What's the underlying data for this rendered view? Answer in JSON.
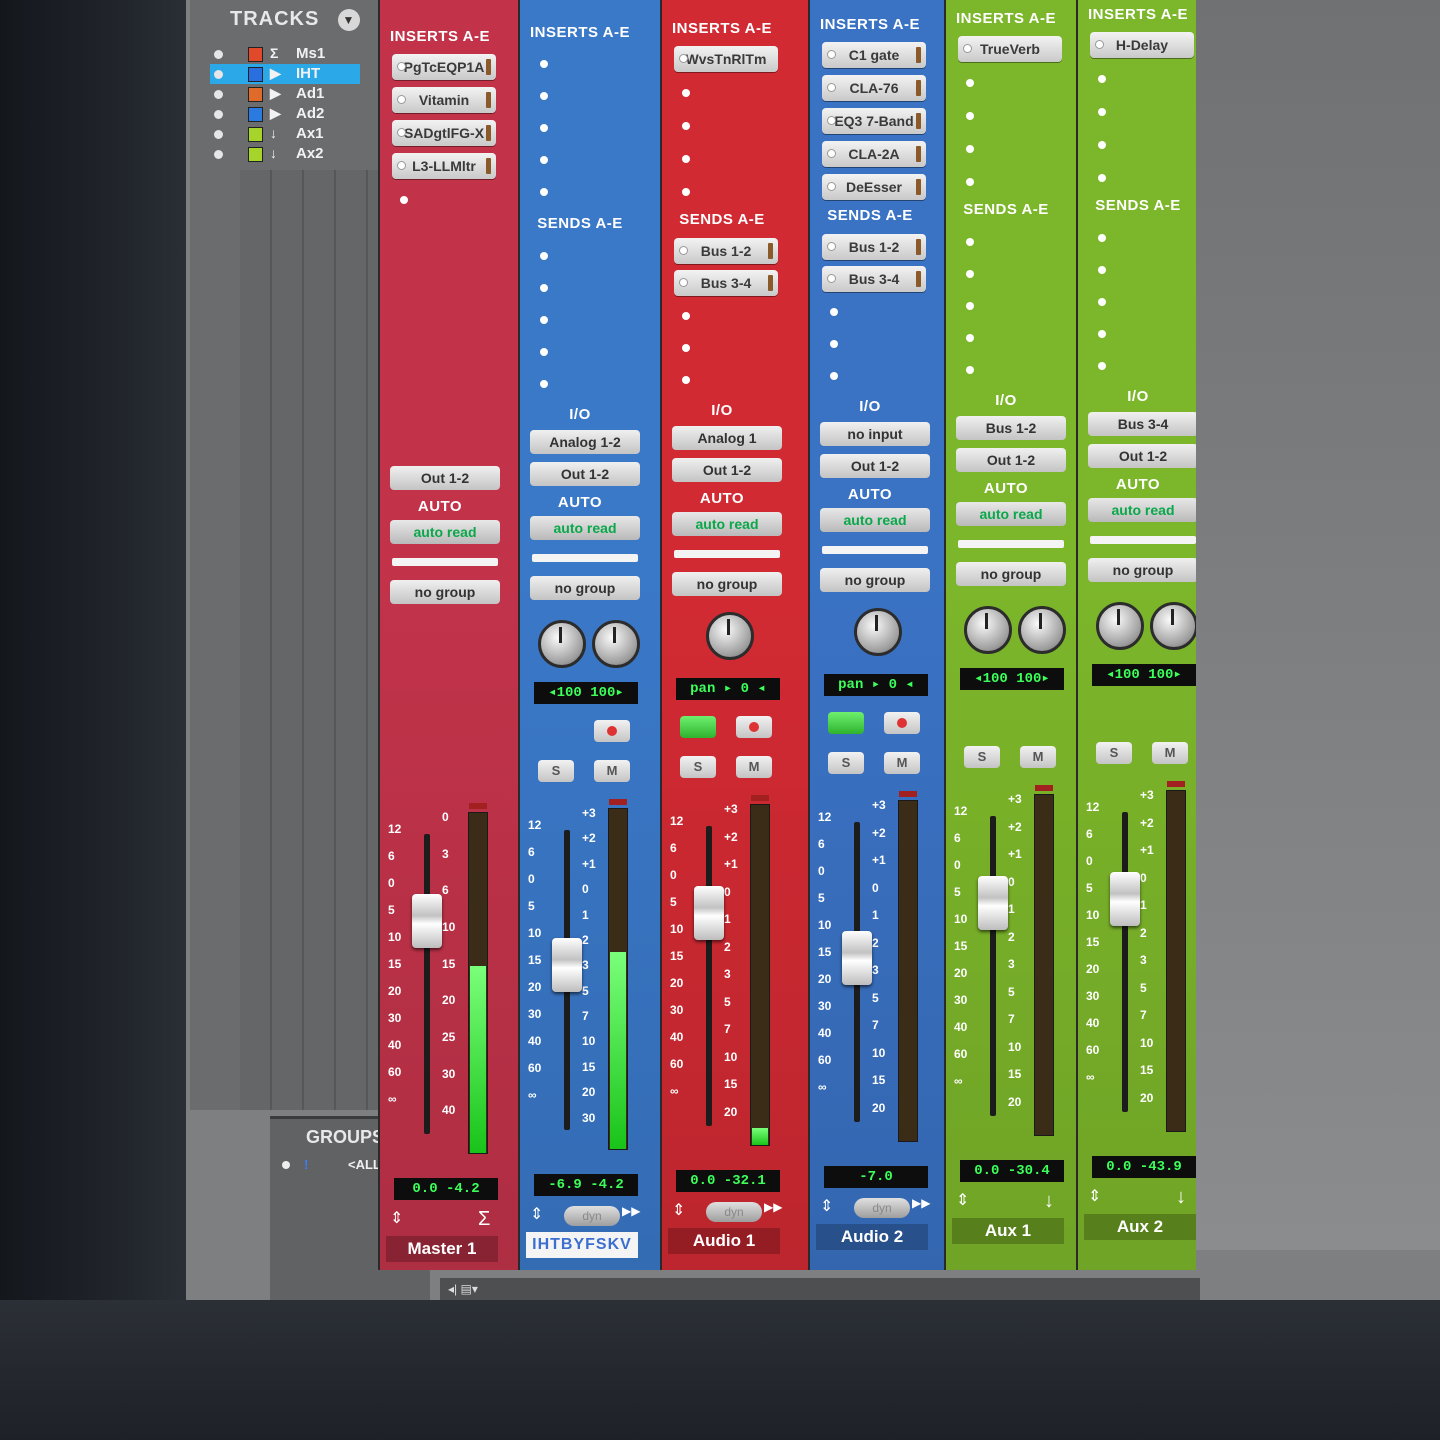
{
  "tracks_panel": {
    "title": "TRACKS",
    "menu_glyph": "▼",
    "tracks": [
      {
        "name": "Ms1",
        "color": "#e04a2a",
        "icon": "Σ"
      },
      {
        "name": "IHT",
        "color": "#2a6fe0",
        "icon": "▶",
        "selected": true
      },
      {
        "name": "Ad1",
        "color": "#e06a2a",
        "icon": "▶"
      },
      {
        "name": "Ad2",
        "color": "#2a7ae0",
        "icon": "▶"
      },
      {
        "name": "Ax1",
        "color": "#a6d42a",
        "icon": "↓"
      },
      {
        "name": "Ax2",
        "color": "#a6d42a",
        "icon": "↓"
      }
    ]
  },
  "groups_panel": {
    "title": "GROUPS",
    "menu_glyph": "▼",
    "all_label": "<ALL>",
    "id_label": "!"
  },
  "footer": {
    "label": "◂| ▤▾"
  },
  "strips": [
    {
      "name": "Master 1",
      "color": "#c2334a",
      "inserts_title": "INSERTS A-E",
      "inserts": [
        "PgTcEQP1A",
        "Vitamin",
        "SADgtlFG-X",
        "L3-LLMltr"
      ],
      "sends_title": "",
      "sends": [],
      "io_title": "",
      "io_input": "",
      "io_output": "Out 1-2",
      "auto_title": "AUTO",
      "auto_mode": "auto read",
      "group": "no group",
      "pan": [],
      "buttons": [],
      "vol": "0.0",
      "peak": "-4.2",
      "bottom_icon": "Σ",
      "scale_fader": [
        "12",
        "6",
        "0",
        "5",
        "10",
        "15",
        "20",
        "30",
        "40",
        "60",
        "∞"
      ],
      "scale_meter": [
        "0",
        "3",
        "6",
        "10",
        "15",
        "20",
        "25",
        "30",
        "40"
      ],
      "meter_level": 0.55
    },
    {
      "name": "IHTBYFSKV",
      "color": "#3a78c8",
      "inserts_title": "INSERTS A-E",
      "inserts": [],
      "sends_title": "SENDS A-E",
      "sends": [],
      "io_title": "I/O",
      "io_input": "Analog 1-2",
      "io_output": "Out 1-2",
      "auto_title": "AUTO",
      "auto_mode": "auto read",
      "group": "no group",
      "pan": [
        "◂100",
        "100▸"
      ],
      "buttons": [
        "rec",
        "S",
        "M"
      ],
      "vol": "-6.9",
      "peak": "-4.2",
      "bottom_icon": "dyn",
      "scale_fader": [
        "12",
        "6",
        "0",
        "5",
        "10",
        "15",
        "20",
        "30",
        "40",
        "60",
        "∞"
      ],
      "scale_meter": [
        "+3",
        "+2",
        "+1",
        "0",
        "1",
        "2",
        "3",
        "5",
        "7",
        "10",
        "15",
        "20",
        "30"
      ],
      "meter_level": 0.58
    },
    {
      "name": "Audio 1",
      "color": "#d22a33",
      "inserts_title": "INSERTS A-E",
      "inserts": [
        "WvsTnRlTm"
      ],
      "sends_title": "SENDS A-E",
      "sends": [
        "Bus 1-2",
        "Bus 3-4"
      ],
      "io_title": "I/O",
      "io_input": "Analog 1",
      "io_output": "Out 1-2",
      "auto_title": "AUTO",
      "auto_mode": "auto read",
      "group": "no group",
      "pan": [
        "pan",
        "▸ 0 ◂"
      ],
      "buttons": [
        "input",
        "rec",
        "S",
        "M"
      ],
      "vol": "0.0",
      "peak": "-32.1",
      "bottom_icon": "dyn",
      "scale_fader": [
        "12",
        "6",
        "0",
        "5",
        "10",
        "15",
        "20",
        "30",
        "40",
        "60",
        "∞"
      ],
      "scale_meter": [
        "+3",
        "+2",
        "+1",
        "0",
        "1",
        "2",
        "3",
        "5",
        "7",
        "10",
        "15",
        "20"
      ],
      "meter_level": 0.05
    },
    {
      "name": "Audio 2",
      "color": "#3a72c4",
      "inserts_title": "INSERTS A-E",
      "inserts": [
        "C1 gate",
        "CLA-76",
        "EQ3 7-Band",
        "CLA-2A",
        "DeEsser"
      ],
      "sends_title": "SENDS A-E",
      "sends": [
        "Bus 1-2",
        "Bus 3-4"
      ],
      "io_title": "I/O",
      "io_input": "no input",
      "io_output": "Out 1-2",
      "auto_title": "AUTO",
      "auto_mode": "auto read",
      "group": "no group",
      "pan": [
        "pan",
        "▸ 0 ◂"
      ],
      "buttons": [
        "input",
        "rec",
        "S",
        "M"
      ],
      "vol": "-7.0",
      "peak": "",
      "bottom_icon": "dyn",
      "scale_fader": [
        "12",
        "6",
        "0",
        "5",
        "10",
        "15",
        "20",
        "30",
        "40",
        "60",
        "∞"
      ],
      "scale_meter": [
        "+3",
        "+2",
        "+1",
        "0",
        "1",
        "2",
        "3",
        "5",
        "7",
        "10",
        "15",
        "20"
      ],
      "meter_level": 0.0
    },
    {
      "name": "Aux 1",
      "color": "#7cb62a",
      "inserts_title": "INSERTS A-E",
      "inserts": [
        "TrueVerb"
      ],
      "sends_title": "SENDS A-E",
      "sends": [],
      "io_title": "I/O",
      "io_input": "Bus 1-2",
      "io_output": "Out 1-2",
      "auto_title": "AUTO",
      "auto_mode": "auto read",
      "group": "no group",
      "pan": [
        "◂100",
        "100▸"
      ],
      "buttons": [
        "S",
        "M"
      ],
      "vol": "0.0",
      "peak": "-30.4",
      "bottom_icon": "↓",
      "scale_fader": [
        "12",
        "6",
        "0",
        "5",
        "10",
        "15",
        "20",
        "30",
        "40",
        "60",
        "∞"
      ],
      "scale_meter": [
        "+3",
        "+2",
        "+1",
        "0",
        "1",
        "2",
        "3",
        "5",
        "7",
        "10",
        "15",
        "20"
      ],
      "meter_level": 0.0
    },
    {
      "name": "Aux 2",
      "color": "#7cb62a",
      "inserts_title": "INSERTS A-E",
      "inserts": [
        "H-Delay"
      ],
      "sends_title": "SENDS A-E",
      "sends": [],
      "io_title": "I/O",
      "io_input": "Bus 3-4",
      "io_output": "Out 1-2",
      "auto_title": "AUTO",
      "auto_mode": "auto read",
      "group": "no group",
      "pan": [
        "◂100",
        "100▸"
      ],
      "buttons": [
        "S",
        "M"
      ],
      "vol": "0.0",
      "peak": "-43.9",
      "bottom_icon": "↓",
      "scale_fader": [
        "12",
        "6",
        "0",
        "5",
        "10",
        "15",
        "20",
        "30",
        "40",
        "60",
        "∞"
      ],
      "scale_meter": [
        "+3",
        "+2",
        "+1",
        "0",
        "1",
        "2",
        "3",
        "5",
        "7",
        "10",
        "15",
        "20"
      ],
      "meter_level": 0.0
    }
  ]
}
